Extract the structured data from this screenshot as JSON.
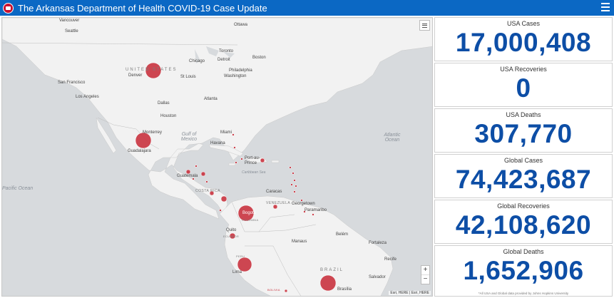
{
  "header": {
    "title": "The Arkansas Department of Health COVID-19 Case Update",
    "colors": {
      "bar": "#0b68c4",
      "logo": "#c8102e"
    }
  },
  "map": {
    "labels": {
      "vancouver": "Vancouver",
      "seattle": "Seattle",
      "ottawa": "Ottawa",
      "toronto": "Toronto",
      "boston": "Boston",
      "chicago": "Chicago",
      "detroit": "Detroit",
      "united_states": "UNITED STATES",
      "denver": "Denver",
      "st_louis": "St Louis",
      "philadelphia": "Philadelphia",
      "washington": "Washington",
      "san_francisco": "San Francisco",
      "los_angeles": "Los Angeles",
      "dallas": "Dallas",
      "atlanta": "Atlanta",
      "houston": "Houston",
      "miami": "Miami",
      "monterrey": "Monterrey",
      "gulf_of_mexico": "Gulf of Mexico",
      "havana": "Havana",
      "port_au_prince": "Port-au-Prince",
      "caribbean_sea": "Caribbean Sea",
      "atlantic_ocean": "Atlantic Ocean",
      "guadalajara": "Guadalajara",
      "guatemala": "Guatemala",
      "costa_rica": "COSTA RICA",
      "pacific_ocean": "Pacific Ocean",
      "caracas": "Caracas",
      "venezuela": "VENEZUELA",
      "georgetown": "Georgetown",
      "paramaribo": "Paramaribo",
      "bogota": "Bogotá",
      "colombia": "COLOMBIA",
      "quito": "Quito",
      "ecuador": "ECUADOR",
      "belem": "Belém",
      "manaus": "Manaus",
      "fortaleza": "Fortaleza",
      "peru": "PERU",
      "recife": "Recife",
      "lima": "Lima",
      "brazil": "BRAZIL",
      "salvador": "Salvador",
      "bolivia": "BOLIVIA",
      "brasilia": "Brasília"
    },
    "bubble_color": "#c9333f",
    "zoom_in": "+",
    "zoom_out": "−",
    "attribution": "Esri, HERE | Esri, HERE"
  },
  "stats": [
    {
      "label": "USA Cases",
      "value": "17,000,408"
    },
    {
      "label": "USA Recoveries",
      "value": "0"
    },
    {
      "label": "USA Deaths",
      "value": "307,770"
    },
    {
      "label": "Global Cases",
      "value": "74,423,687"
    },
    {
      "label": "Global Recoveries",
      "value": "42,108,620"
    },
    {
      "label": "Global Deaths",
      "value": "1,652,906"
    }
  ],
  "footnote": "*All USA and Global data provided by Johns Hopkins University",
  "value_color": "#0d4ea6"
}
